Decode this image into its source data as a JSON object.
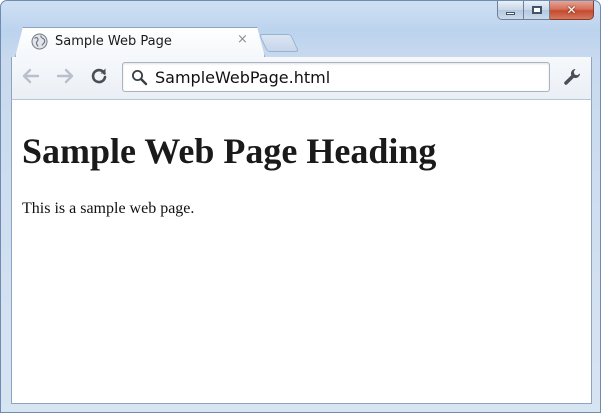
{
  "window": {
    "caption_buttons": {
      "minimize_icon": "minimize-icon",
      "maximize_icon": "maximize-icon",
      "close_icon": "close-icon",
      "close_glyph": "✕"
    }
  },
  "tab": {
    "title": "Sample Web Page",
    "close_glyph": "×",
    "favicon": "globe-icon"
  },
  "toolbar": {
    "back_icon": "arrow-left-icon",
    "forward_icon": "arrow-right-icon",
    "reload_icon": "reload-icon",
    "address": "SampleWebPage.html",
    "address_icon": "search-icon",
    "menu_icon": "wrench-icon"
  },
  "page": {
    "heading": "Sample Web Page Heading",
    "paragraph": "This is a sample web page."
  },
  "colors": {
    "frame": "#bcd3ee",
    "close_button": "#c44a2f",
    "text": "#1a1a1a"
  }
}
